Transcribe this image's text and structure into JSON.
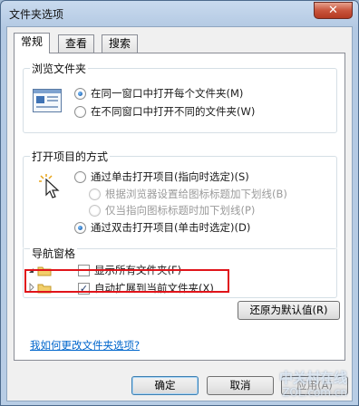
{
  "window": {
    "title": "文件夹选项",
    "close_glyph": "✕"
  },
  "tabs": [
    {
      "label": "常规",
      "active": true
    },
    {
      "label": "查看",
      "active": false
    },
    {
      "label": "搜索",
      "active": false
    }
  ],
  "browse": {
    "title": "浏览文件夹",
    "options": [
      {
        "label": "在同一窗口中打开每个文件夹(M)",
        "selected": true
      },
      {
        "label": "在不同窗口中打开不同的文件夹(W)",
        "selected": false
      }
    ]
  },
  "open": {
    "title": "打开项目的方式",
    "single_click": {
      "label": "通过单击打开项目(指向时选定)(S)",
      "selected": false
    },
    "sub_options": [
      {
        "label": "根据浏览器设置给图标标题加下划线(B)",
        "enabled": false
      },
      {
        "label": "仅当指向图标标题时加下划线(P)",
        "enabled": false
      }
    ],
    "double_click": {
      "label": "通过双击打开项目(单击时选定)(D)",
      "selected": true
    }
  },
  "nav": {
    "title": "导航窗格",
    "show_all": {
      "label": "显示所有文件夹(F)",
      "checked": false
    },
    "auto_expand": {
      "label": "自动扩展到当前文件夹(X)",
      "checked": true
    }
  },
  "restore_button": "还原为默认值(R)",
  "help_link": "我如何更改文件夹选项?",
  "footer": {
    "ok": "确定",
    "cancel": "取消",
    "apply": "应用(A)"
  },
  "watermark": {
    "line1": "中关村在线",
    "line2": "ZOL.com.cn"
  },
  "colors": {
    "highlight_border": "#e0141a",
    "link": "#0066cc"
  }
}
